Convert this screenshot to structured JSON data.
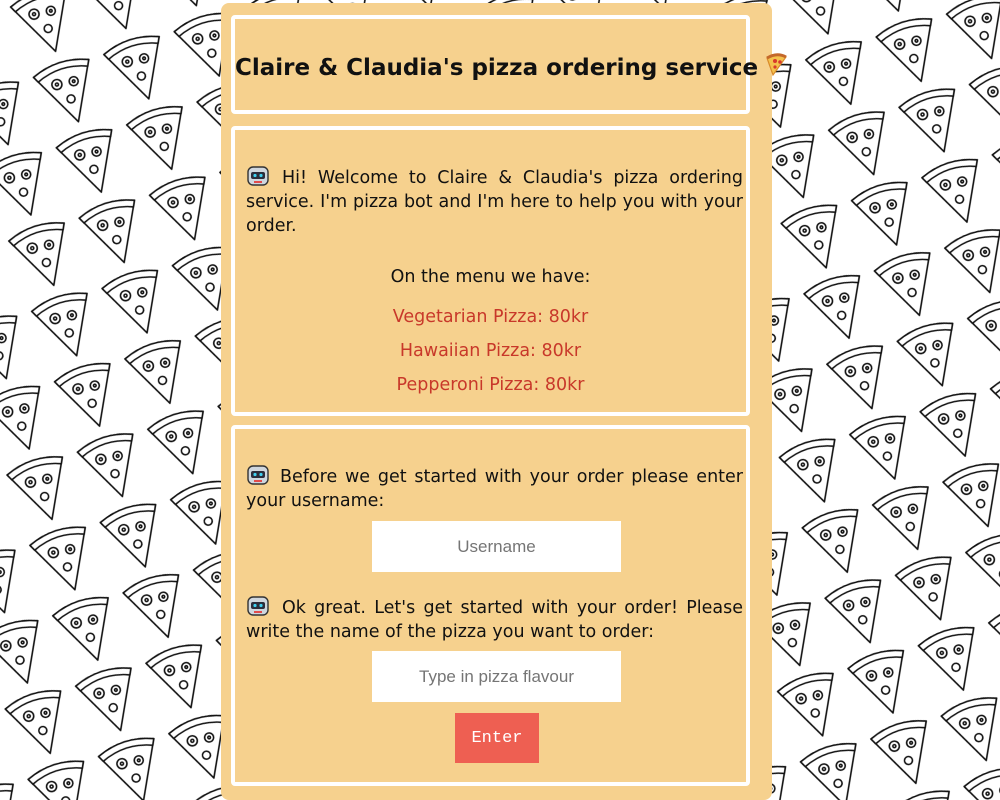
{
  "header": {
    "title": "Claire & Claudia's pizza ordering service"
  },
  "welcome": {
    "message": "Hi! Welcome to Claire & Claudia's pizza ordering service. I'm pizza bot and I'm here to help you with your order.",
    "menu_heading": "On the menu we have:",
    "menu_items": [
      "Vegetarian Pizza: 80kr",
      "Hawaiian Pizza: 80kr",
      "Pepperoni Pizza: 80kr"
    ]
  },
  "order": {
    "username_prompt": "Before we get started with your order please enter your username:",
    "username_placeholder": "Username",
    "username_value": "",
    "flavour_prompt": "Ok great. Let's get started with your order! Please write the name of the pizza you want to order:",
    "flavour_placeholder": "Type in pizza flavour",
    "flavour_value": "",
    "enter_label": "Enter"
  },
  "colors": {
    "panel": "#f6d18e",
    "menu_item": "#c8382a",
    "button": "#ee5f52"
  },
  "icons": {
    "bot": "robot-icon",
    "title": "pizza-slice-icon",
    "background": "pizza-pattern"
  }
}
